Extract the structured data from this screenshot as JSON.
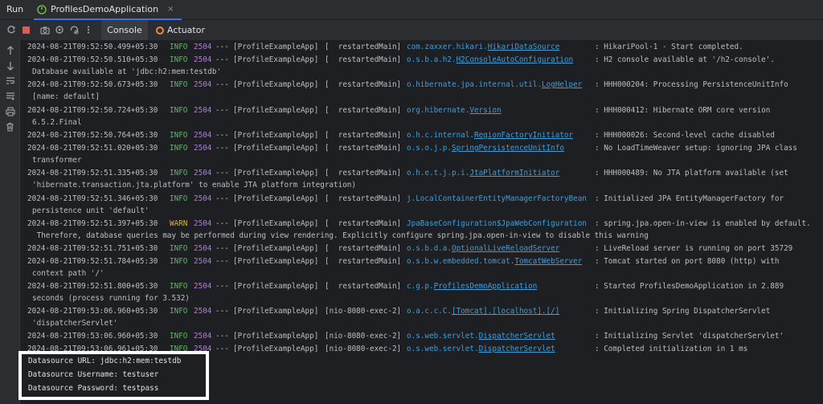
{
  "header": {
    "run_label": "Run",
    "config_name": "ProfilesDemoApplication",
    "close_glyph": "×"
  },
  "tabs": {
    "console": "Console",
    "actuator": "Actuator"
  },
  "colors": {
    "info": "#5fb865",
    "warn": "#d6b04a",
    "pid": "#b07cd8",
    "logger": "#3d9fdc",
    "stop": "#db5c5c"
  },
  "toolbar_icons": [
    "rerun-icon",
    "stop-icon",
    "camera-icon",
    "settings-icon",
    "refresh-icon",
    "more-icon"
  ],
  "sidebar_icons": [
    "arrow-up-icon",
    "arrow-down-icon",
    "soft-wrap-icon",
    "scroll-to-end-icon",
    "print-icon",
    "trash-icon"
  ],
  "log": [
    {
      "ts": "2024-08-21T09:52:50.499+05:30",
      "level": "INFO",
      "pid": "2504",
      "sep": "---",
      "app": "[ProfileExampleApp]",
      "thread": "[  restartedMain]",
      "logger_prefix": "com.zaxxer.hikari.",
      "logger_link": "HikariDataSource",
      "msg": ": HikariPool-1 - Start completed.",
      "cont": ""
    },
    {
      "ts": "2024-08-21T09:52:50.510+05:30",
      "level": "INFO",
      "pid": "2504",
      "sep": "---",
      "app": "[ProfileExampleApp]",
      "thread": "[  restartedMain]",
      "logger_prefix": "o.s.b.a.h2.",
      "logger_link": "H2ConsoleAutoConfiguration",
      "msg": ": H2 console available at '/h2-console'.",
      "cont": "Database available at 'jdbc:h2:mem:testdb'"
    },
    {
      "ts": "2024-08-21T09:52:50.673+05:30",
      "level": "INFO",
      "pid": "2504",
      "sep": "---",
      "app": "[ProfileExampleApp]",
      "thread": "[  restartedMain]",
      "logger_prefix": "o.hibernate.jpa.internal.util.",
      "logger_link": "LogHelper",
      "msg": ": HHH000204: Processing PersistenceUnitInfo",
      "cont": "[name: default]"
    },
    {
      "ts": "2024-08-21T09:52:50.724+05:30",
      "level": "INFO",
      "pid": "2504",
      "sep": "---",
      "app": "[ProfileExampleApp]",
      "thread": "[  restartedMain]",
      "logger_prefix": "org.hibernate.",
      "logger_link": "Version",
      "msg": ": HHH000412: Hibernate ORM core version",
      "cont": "6.5.2.Final"
    },
    {
      "ts": "2024-08-21T09:52:50.764+05:30",
      "level": "INFO",
      "pid": "2504",
      "sep": "---",
      "app": "[ProfileExampleApp]",
      "thread": "[  restartedMain]",
      "logger_prefix": "o.h.c.internal.",
      "logger_link": "RegionFactoryInitiator",
      "msg": ": HHH000026: Second-level cache disabled",
      "cont": ""
    },
    {
      "ts": "2024-08-21T09:52:51.020+05:30",
      "level": "INFO",
      "pid": "2504",
      "sep": "---",
      "app": "[ProfileExampleApp]",
      "thread": "[  restartedMain]",
      "logger_prefix": "o.s.o.j.p.",
      "logger_link": "SpringPersistenceUnitInfo",
      "msg": ": No LoadTimeWeaver setup: ignoring JPA class",
      "cont": "transformer"
    },
    {
      "ts": "2024-08-21T09:52:51.335+05:30",
      "level": "INFO",
      "pid": "2504",
      "sep": "---",
      "app": "[ProfileExampleApp]",
      "thread": "[  restartedMain]",
      "logger_prefix": "o.h.e.t.j.p.i.",
      "logger_link": "JtaPlatformInitiator",
      "msg": ": HHH000489: No JTA platform available (set",
      "cont": "'hibernate.transaction.jta.platform' to enable JTA platform integration)"
    },
    {
      "ts": "2024-08-21T09:52:51.346+05:30",
      "level": "INFO",
      "pid": "2504",
      "sep": "---",
      "app": "[ProfileExampleApp]",
      "thread": "[  restartedMain]",
      "logger_prefix": "j.LocalContainerEntityManagerFactoryBean",
      "logger_link": "",
      "msg": ": Initialized JPA EntityManagerFactory for",
      "cont": "persistence unit 'default'"
    },
    {
      "ts": "2024-08-21T09:52:51.397+05:30",
      "level": "WARN",
      "pid": "2504",
      "sep": "---",
      "app": "[ProfileExampleApp]",
      "thread": "[  restartedMain]",
      "logger_prefix": "JpaBaseConfiguration$JpaWebConfiguration",
      "logger_link": "",
      "msg": ": spring.jpa.open-in-view is enabled by default.",
      "cont": " Therefore, database queries may be performed during view rendering. Explicitly configure spring.jpa.open-in-view to disable this warning"
    },
    {
      "ts": "2024-08-21T09:52:51.751+05:30",
      "level": "INFO",
      "pid": "2504",
      "sep": "---",
      "app": "[ProfileExampleApp]",
      "thread": "[  restartedMain]",
      "logger_prefix": "o.s.b.d.a.",
      "logger_link": "OptionalLiveReloadServer",
      "msg": ": LiveReload server is running on port 35729",
      "cont": ""
    },
    {
      "ts": "2024-08-21T09:52:51.784+05:30",
      "level": "INFO",
      "pid": "2504",
      "sep": "---",
      "app": "[ProfileExampleApp]",
      "thread": "[  restartedMain]",
      "logger_prefix": "o.s.b.w.embedded.tomcat.",
      "logger_link": "TomcatWebServer",
      "msg": ": Tomcat started on port 8080 (http) with",
      "cont": "context path '/'"
    },
    {
      "ts": "2024-08-21T09:52:51.800+05:30",
      "level": "INFO",
      "pid": "2504",
      "sep": "---",
      "app": "[ProfileExampleApp]",
      "thread": "[  restartedMain]",
      "logger_prefix": "c.g.p.",
      "logger_link": "ProfilesDemoApplication",
      "msg": ": Started ProfilesDemoApplication in 2.889",
      "cont": "seconds (process running for 3.532)"
    },
    {
      "ts": "2024-08-21T09:53:06.960+05:30",
      "level": "INFO",
      "pid": "2504",
      "sep": "---",
      "app": "[ProfileExampleApp]",
      "thread": "[nio-8080-exec-2]",
      "logger_prefix": "o.a.c.c.C.",
      "logger_link": "[Tomcat].[localhost].[/]",
      "msg": ": Initializing Spring DispatcherServlet",
      "cont": "'dispatcherServlet'"
    },
    {
      "ts": "2024-08-21T09:53:06.960+05:30",
      "level": "INFO",
      "pid": "2504",
      "sep": "---",
      "app": "[ProfileExampleApp]",
      "thread": "[nio-8080-exec-2]",
      "logger_prefix": "o.s.web.servlet.",
      "logger_link": "DispatcherServlet",
      "msg": ": Initializing Servlet 'dispatcherServlet'",
      "cont": ""
    },
    {
      "ts": "2024-08-21T09:53:06.961+05:30",
      "level": "INFO",
      "pid": "2504",
      "sep": "---",
      "app": "[ProfileExampleApp]",
      "thread": "[nio-8080-exec-2]",
      "logger_prefix": "o.s.web.servlet.",
      "logger_link": "DispatcherServlet",
      "msg": ": Completed initialization in 1 ms",
      "cont": ""
    }
  ],
  "datasource": [
    "Datasource URL: jdbc:h2:mem:testdb",
    "Datasource Username: testuser",
    "Datasource Password: testpass"
  ]
}
